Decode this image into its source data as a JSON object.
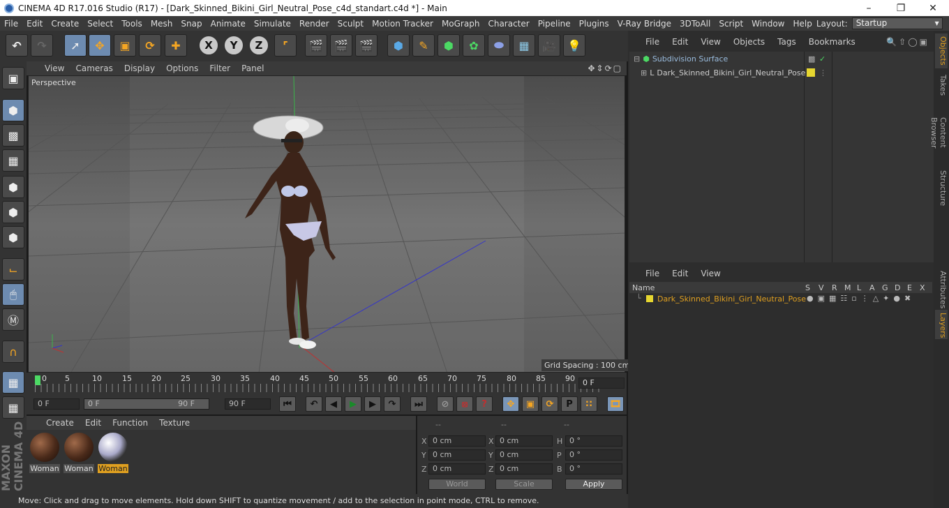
{
  "window": {
    "title": "CINEMA 4D R17.016 Studio (R17) - [Dark_Skinned_Bikini_Girl_Neutral_Pose_c4d_standart.c4d *] - Main"
  },
  "menu": [
    "File",
    "Edit",
    "Create",
    "Select",
    "Tools",
    "Mesh",
    "Snap",
    "Animate",
    "Simulate",
    "Render",
    "Sculpt",
    "Motion Tracker",
    "MoGraph",
    "Character",
    "Pipeline",
    "Plugins",
    "V-Ray Bridge",
    "3DToAll",
    "Script",
    "Window",
    "Help"
  ],
  "layout": {
    "label": "Layout:",
    "value": "Startup"
  },
  "toolbar": {
    "x": "X",
    "y": "Y",
    "z": "Z"
  },
  "viewport": {
    "menu": [
      "View",
      "Cameras",
      "Display",
      "Options",
      "Filter",
      "Panel"
    ],
    "label": "Perspective",
    "grid_spacing": "Grid Spacing : 100 cm"
  },
  "timeline": {
    "ticks": [
      "0",
      "5",
      "10",
      "15",
      "20",
      "25",
      "30",
      "35",
      "40",
      "45",
      "50",
      "55",
      "60",
      "65",
      "70",
      "75",
      "80",
      "85",
      "90"
    ],
    "current_frame": "0 F",
    "start": "0 F",
    "slider_start": "0 F",
    "slider_end": "90 F",
    "end": "90 F"
  },
  "materials": {
    "menu": [
      "Create",
      "Edit",
      "Function",
      "Texture"
    ],
    "items": [
      {
        "name": "Woman",
        "selected": false
      },
      {
        "name": "Woman",
        "selected": false
      },
      {
        "name": "Woman",
        "selected": true
      }
    ]
  },
  "coords": {
    "headers": [
      "--",
      "--",
      "--"
    ],
    "pos": {
      "x": "0 cm",
      "y": "0 cm",
      "z": "0 cm"
    },
    "size": {
      "x": "0 cm",
      "y": "0 cm",
      "z": "0 cm"
    },
    "rot": {
      "h": "0 °",
      "p": "0 °",
      "b": "0 °"
    },
    "labels": {
      "x": "X",
      "y": "Y",
      "z": "Z",
      "h": "H",
      "p": "P",
      "b": "B"
    },
    "world": "World",
    "scale": "Scale",
    "apply": "Apply"
  },
  "objects": {
    "menu": [
      "File",
      "Edit",
      "View",
      "Objects",
      "Tags",
      "Bookmarks"
    ],
    "items": [
      "Subdivision Surface",
      "Dark_Skinned_Bikini_Girl_Neutral_Pose"
    ]
  },
  "layers": {
    "menu": [
      "File",
      "Edit",
      "View"
    ],
    "name_header": "Name",
    "cols": [
      "S",
      "V",
      "R",
      "M",
      "L",
      "A",
      "G",
      "D",
      "E",
      "X"
    ],
    "row": "Dark_Skinned_Bikini_Girl_Neutral_Pose"
  },
  "side_tabs": [
    "Objects",
    "Takes",
    "Content Browser",
    "Structure",
    "Attributes",
    "Layers"
  ],
  "status": "Move: Click and drag to move elements. Hold down SHIFT to quantize movement / add to the selection in point mode, CTRL to remove.",
  "brand": {
    "maxon": "MAXON",
    "product": "CINEMA 4D"
  },
  "colors": {
    "accent": "#e0a020",
    "active": "#6d8bb0",
    "layer_color": "#e6d630"
  }
}
